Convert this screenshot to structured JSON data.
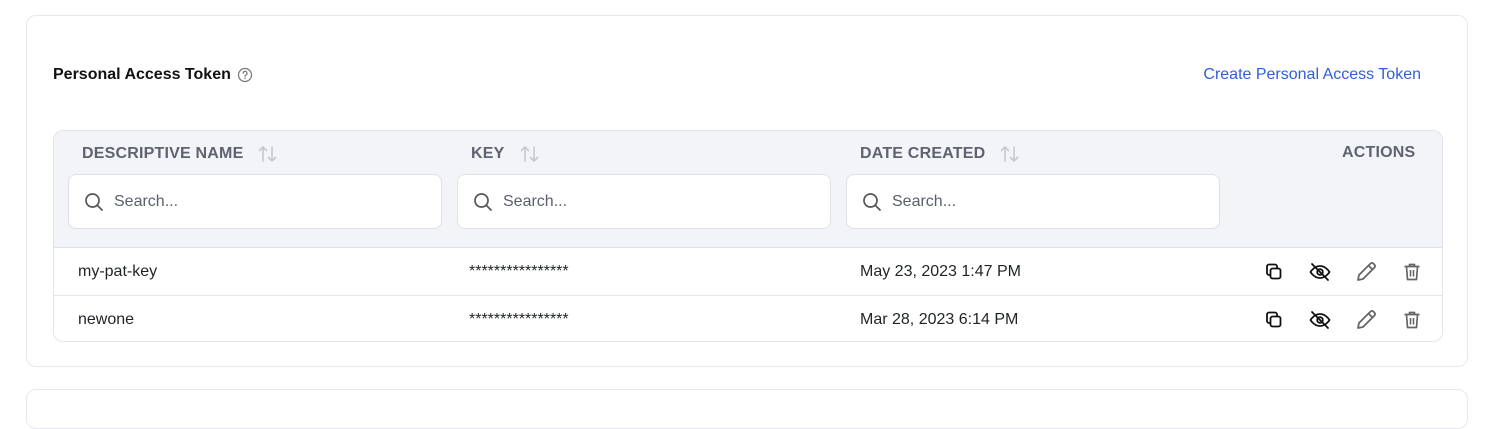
{
  "section": {
    "title": "Personal Access Token",
    "create_link": "Create Personal Access Token"
  },
  "table": {
    "columns": [
      {
        "label": "DESCRIPTIVE NAME",
        "search_placeholder": "Search..."
      },
      {
        "label": "KEY",
        "search_placeholder": "Search..."
      },
      {
        "label": "DATE CREATED",
        "search_placeholder": "Search..."
      },
      {
        "label": "ACTIONS"
      }
    ],
    "rows": [
      {
        "name": "my-pat-key",
        "key": "****************",
        "date": "May 23, 2023 1:47 PM"
      },
      {
        "name": "newone",
        "key": "****************",
        "date": "Mar 28, 2023 6:14 PM"
      }
    ]
  },
  "icons": {
    "help": "help-circle-icon",
    "sort": "sort-icon",
    "search": "search-icon",
    "copy": "copy-icon",
    "hide": "eye-off-icon",
    "edit": "pencil-icon",
    "delete": "trash-icon"
  },
  "colors": {
    "link": "#2f5fd7",
    "header_bg": "#f3f4f7",
    "header_text": "#5d6370"
  }
}
